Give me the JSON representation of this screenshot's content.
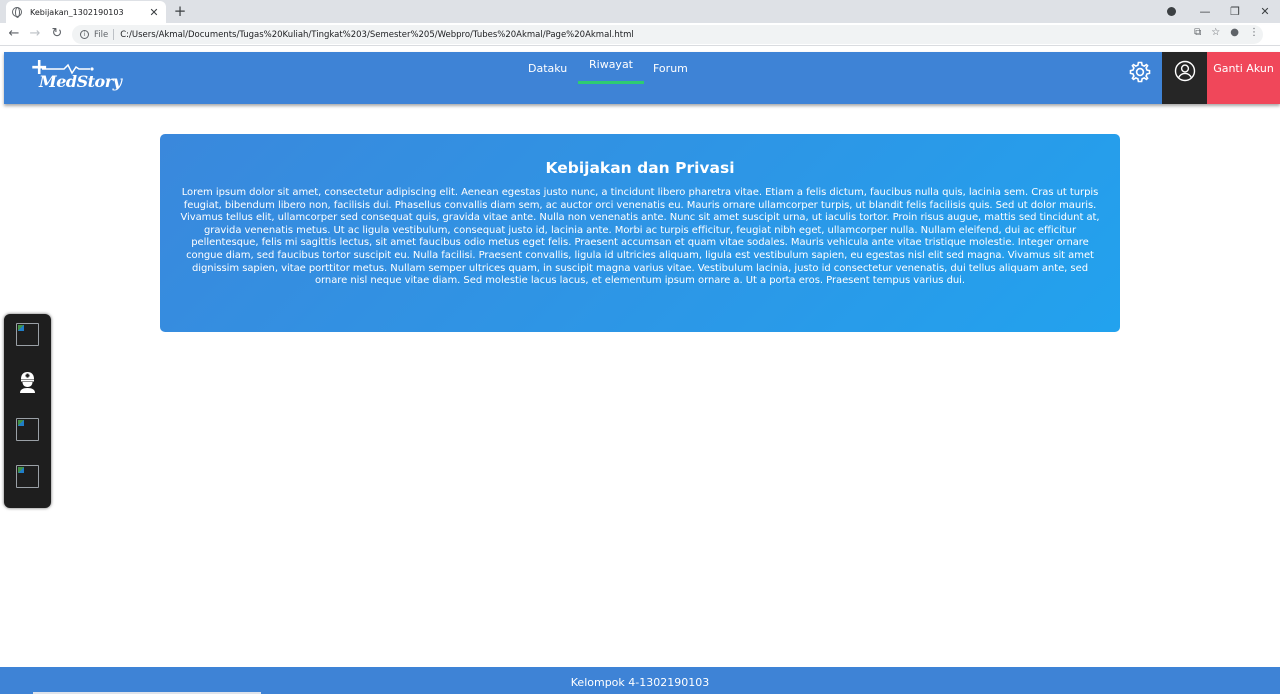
{
  "browser": {
    "tab_title": "Kebijakan_1302190103",
    "tab_close": "✕",
    "new_tab": "+",
    "back": "←",
    "forward": "→",
    "reload": "↻",
    "scheme_label": "File",
    "url": "C:/Users/Akmal/Documents/Tugas%20Kuliah/Tingkat%203/Semester%205/Webpro/Tubes%20Akmal/Page%20Akmal.html",
    "window_controls": {
      "minimize": "—",
      "restore": "❐",
      "close": "✕"
    },
    "toolbar_icons": {
      "translate": "⧉",
      "star": "☆",
      "account": "●",
      "menu": "⋮"
    }
  },
  "header": {
    "logo_text": "MedStory",
    "nav": [
      {
        "label": "Dataku",
        "active": false
      },
      {
        "label": "Riwayat",
        "active": true
      },
      {
        "label": "Forum",
        "active": false
      }
    ],
    "settings_icon": "gear-icon",
    "user_icon": "user-circle-icon",
    "ganti_akun_label": "Ganti Akun"
  },
  "policy": {
    "title": "Kebijakan dan Privasi",
    "body": "Lorem ipsum dolor sit amet, consectetur adipiscing elit. Aenean egestas justo nunc, a tincidunt libero pharetra vitae. Etiam a felis dictum, faucibus nulla quis, lacinia sem. Cras ut turpis feugiat, bibendum libero non, facilisis dui. Phasellus convallis diam sem, ac auctor orci venenatis eu. Mauris ornare ullamcorper turpis, ut blandit felis facilisis quis. Sed ut dolor mauris. Vivamus tellus elit, ullamcorper sed consequat quis, gravida vitae ante. Nulla non venenatis ante. Nunc sit amet suscipit urna, ut iaculis tortor. Proin risus augue, mattis sed tincidunt at, gravida venenatis metus. Ut ac ligula vestibulum, consequat justo id, lacinia ante. Morbi ac turpis efficitur, feugiat nibh eget, ullamcorper nulla. Nullam eleifend, dui ac efficitur pellentesque, felis mi sagittis lectus, sit amet faucibus odio metus eget felis. Praesent accumsan et quam vitae sodales. Mauris vehicula ante vitae tristique molestie. Integer ornare congue diam, sed faucibus tortor suscipit eu. Nulla facilisi. Praesent convallis, ligula id ultricies aliquam, ligula est vestibulum sapien, eu egestas nisl elit sed magna. Vivamus sit amet dignissim sapien, vitae porttitor metus. Nullam semper ultrices quam, in suscipit magna varius vitae. Vestibulum lacinia, justo id consectetur venenatis, dui tellus aliquam ante, sed ornare nisl neque vitae diam. Sed molestie lacus lacus, et elementum ipsum ornare a. Ut a porta eros. Praesent tempus varius dui."
  },
  "side_bar": {
    "items": [
      "broken-image-icon",
      "doctor-icon",
      "broken-image-icon",
      "broken-image-icon"
    ]
  },
  "footer": {
    "text": "Kelompok 4-1302190103"
  },
  "colors": {
    "header_blue": "#3e83d6",
    "active_underline": "#2ecc71",
    "ganti_akun_red": "#f0475a",
    "user_box_dark": "#262626",
    "card_gradient_start": "#3a88dc",
    "card_gradient_end": "#22a2ee"
  }
}
